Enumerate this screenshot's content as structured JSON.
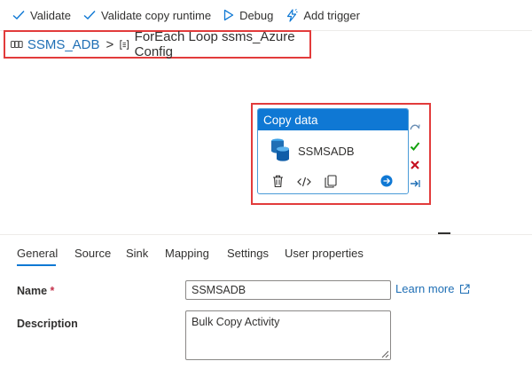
{
  "toolbar": {
    "validate_label": "Validate",
    "validate_copy_runtime_label": "Validate copy runtime",
    "debug_label": "Debug",
    "add_trigger_label": "Add trigger"
  },
  "breadcrumb": {
    "pipeline": "SSMS_ADB",
    "separator": ">",
    "current": "ForEach Loop ssms_Azure Config"
  },
  "activity": {
    "type_label": "Copy data",
    "name": "SSMSADB"
  },
  "tabs": [
    "General",
    "Source",
    "Sink",
    "Mapping",
    "Settings",
    "User properties"
  ],
  "active_tab": "General",
  "form": {
    "name_label": "Name",
    "required_mark": "*",
    "name_value": "SSMSADB",
    "learn_more": "Learn more",
    "description_label": "Description",
    "description_value": "Bulk Copy Activity"
  },
  "colors": {
    "accent": "#0f78d4",
    "link": "#1f6fb5",
    "highlight": "#e23b3b",
    "success": "#13a10e",
    "failure": "#c50f1f"
  }
}
